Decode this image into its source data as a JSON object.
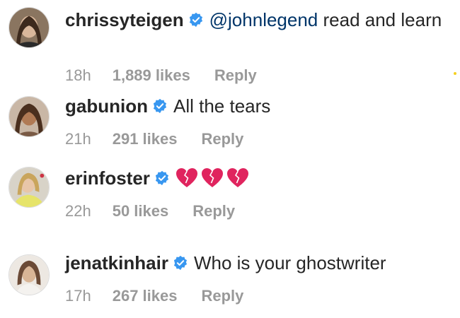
{
  "colors": {
    "username": "#262626",
    "mention": "#003569",
    "meta": "#999999",
    "verified_badge": "#3897f0",
    "heart": "#e0245e"
  },
  "comments": [
    {
      "username": "chrissyteigen",
      "verified": true,
      "mention": "@johnlegend",
      "text": " read and learn",
      "time": "18h",
      "likes": "1,889 likes",
      "reply": "Reply"
    },
    {
      "username": "gabunion",
      "verified": true,
      "text": "All the tears",
      "time": "21h",
      "likes": "291 likes",
      "reply": "Reply"
    },
    {
      "username": "erinfoster",
      "verified": true,
      "emoji": [
        "broken-heart-icon",
        "broken-heart-icon",
        "broken-heart-icon"
      ],
      "time": "22h",
      "likes": "50 likes",
      "reply": "Reply"
    },
    {
      "username": "jenatkinhair",
      "verified": true,
      "text": "Who is your ghostwriter",
      "time": "17h",
      "likes": "267 likes",
      "reply": "Reply"
    }
  ]
}
